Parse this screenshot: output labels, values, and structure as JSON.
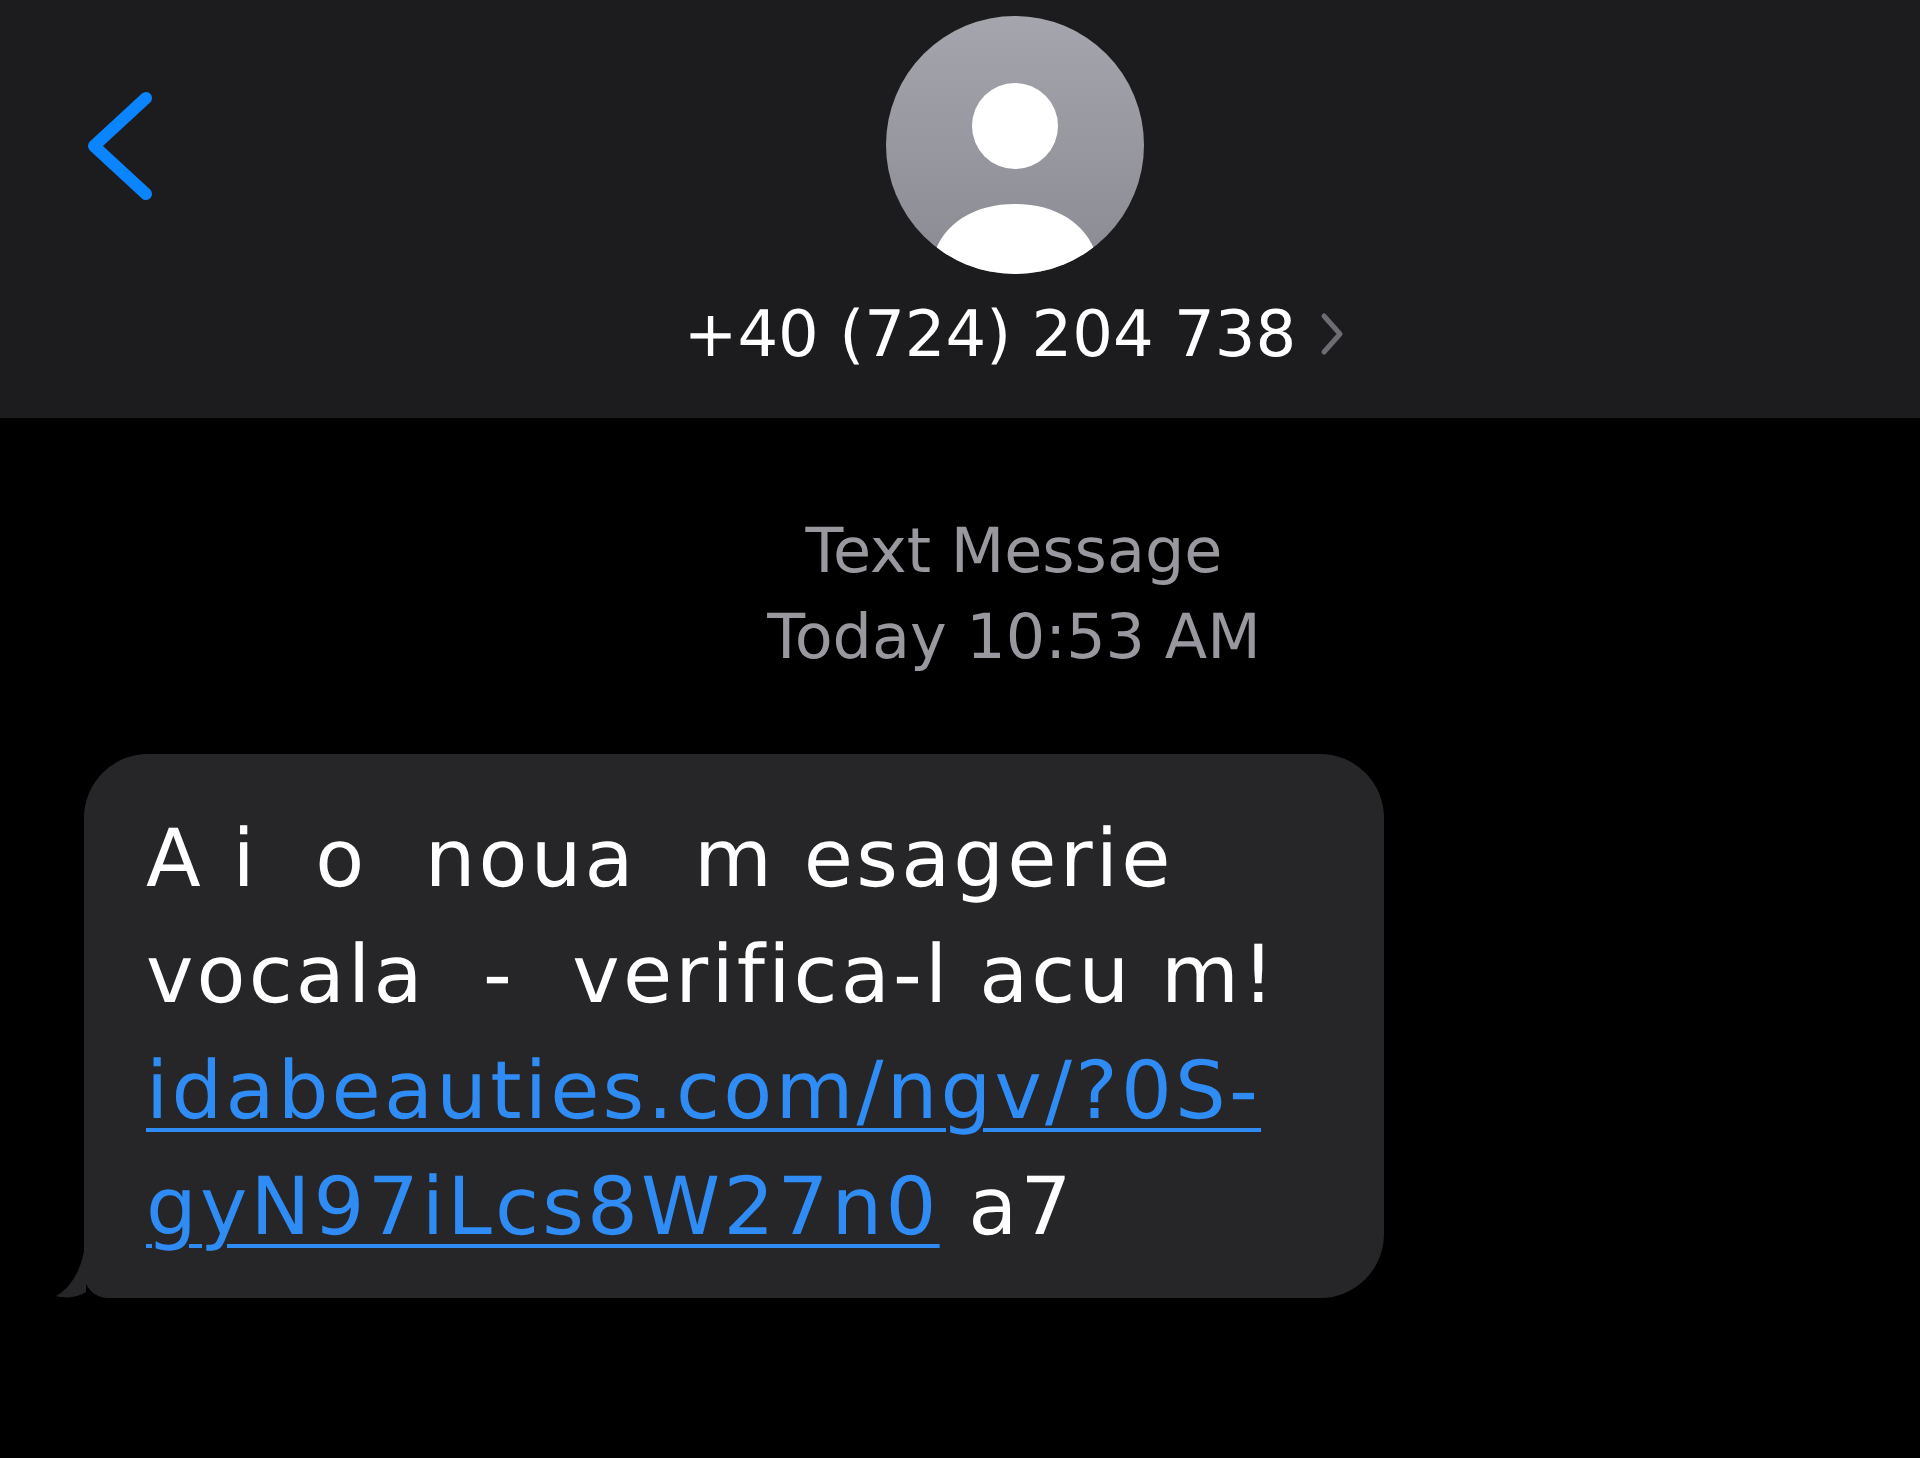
{
  "header": {
    "contact": "+40 (724) 204 738"
  },
  "thread_info": {
    "service": "Text Message",
    "time": "Today 10:53 AM"
  },
  "messages": [
    {
      "kind": "incoming",
      "text": "A i  o  noua  m esagerie vocala  -  verifica-l acu m!",
      "link_lines": [
        "idabeauties.com/ngv/?0S-",
        "gyN97iLcs8W27n0"
      ],
      "after_link": "a7"
    }
  ]
}
